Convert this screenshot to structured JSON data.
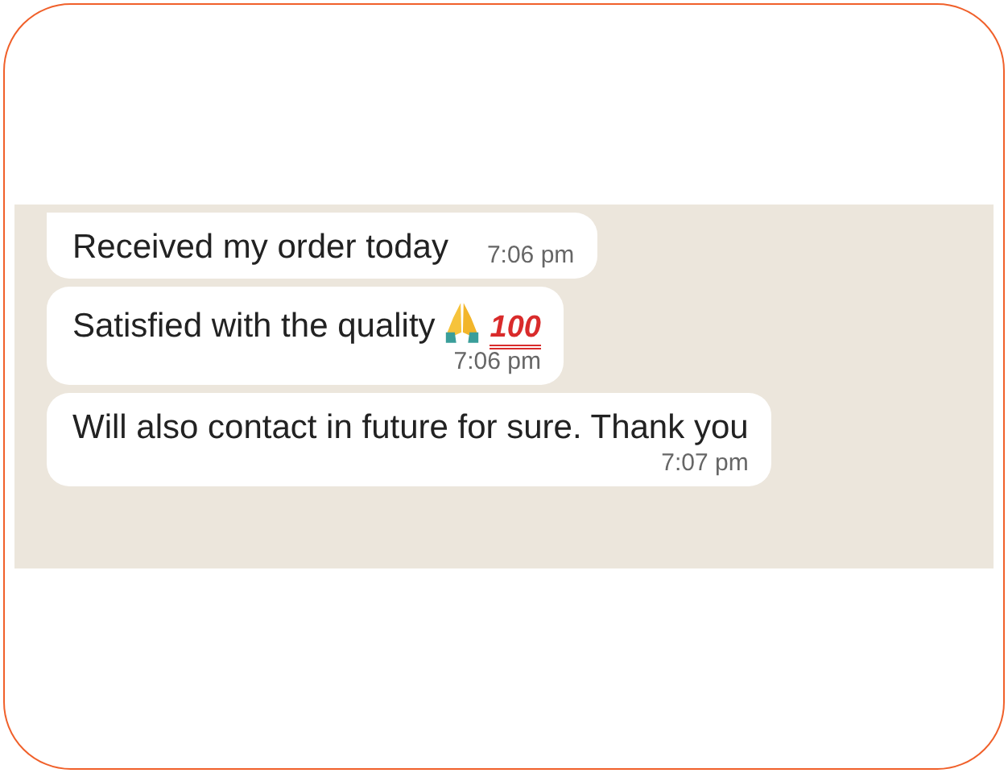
{
  "messages": [
    {
      "kind": "plain",
      "text": "Received my order today",
      "time": "7:06 pm",
      "tail": true
    },
    {
      "kind": "emoji",
      "text": "Satisfied with the quality",
      "emoji_text": "100",
      "time": "7:06 pm",
      "tail": false
    },
    {
      "kind": "plain",
      "text": "Will also contact in future for sure. Thank you",
      "time": "7:07 pm",
      "tail": false
    }
  ]
}
